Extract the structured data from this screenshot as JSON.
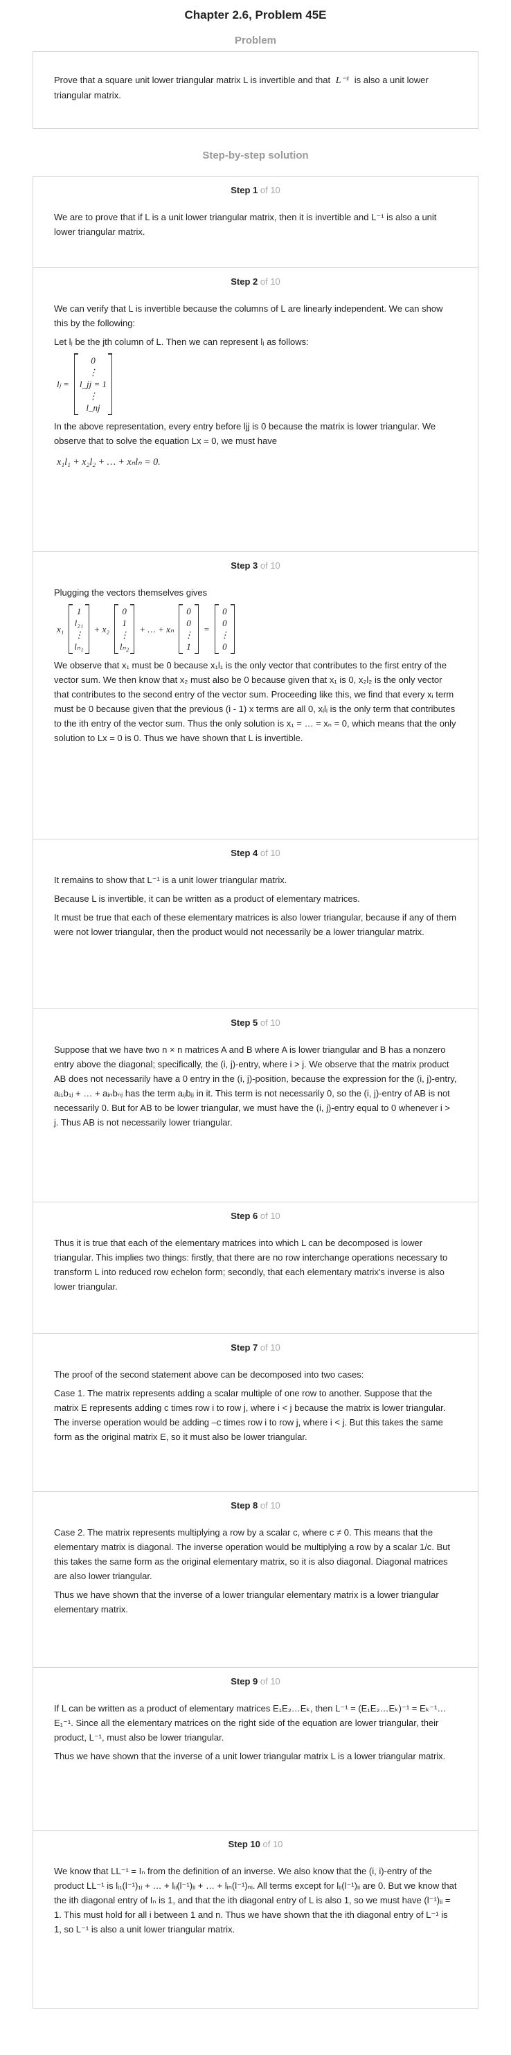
{
  "header": {
    "title": "Chapter 2.6, Problem 45E",
    "problem_heading": "Problem",
    "solution_heading": "Step-by-step solution"
  },
  "problem": {
    "text_before": "Prove that a square unit lower triangular matrix L is invertible and that",
    "math": "L⁻¹",
    "text_after": "is also a unit lower triangular matrix."
  },
  "steps": [
    {
      "label": "Step 1",
      "of": "of 10",
      "paragraphs": [
        "We are to prove that if L is a unit lower triangular matrix, then it is invertible and L⁻¹ is also a unit lower triangular matrix."
      ]
    },
    {
      "label": "Step 2",
      "of": "of 10",
      "paragraphs": [
        "We can verify that L is invertible because the columns of L are linearly independent. We can show this by the following:",
        "Let lⱼ be the jth column of L. Then we can represent lⱼ as follows:",
        "In the above representation, every entry before ljj is 0 because the matrix is lower triangular. We observe that to solve the equation Lx = 0, we must have",
        "x₁l₁ + x₂l₂ + … + xₙlₙ = 0."
      ],
      "vector_lhs": "lⱼ =",
      "vector_entries": [
        "0",
        "⋮",
        "l_jj = 1",
        "⋮",
        "l_nj"
      ]
    },
    {
      "label": "Step 3",
      "of": "of 10",
      "paragraphs": [
        "Plugging the vectors themselves gives",
        "We observe that x₁ must be 0 because x₁l₁ is the only vector that contributes to the first entry of the vector sum. We then know that x₂ must also be 0 because given that x₁ is 0, x₂l₂ is the only vector that contributes to the second entry of the vector sum. Proceeding like this, we find that every xᵢ term must be 0 because given that the previous (i - 1) x terms are all 0, xᵢlᵢ is the only term that contributes to the ith entry of the vector sum. Thus the only solution is x₁ = … = xₙ = 0, which means that the only solution to Lx = 0 is 0. Thus we have shown that L is invertible."
      ],
      "eq": {
        "v1": [
          "1",
          "l₂₁",
          "⋮",
          "lₙ₁"
        ],
        "v2": [
          "0",
          "1",
          "⋮",
          "lₙ₂"
        ],
        "vn": [
          "0",
          "0",
          "⋮",
          "1"
        ],
        "rhs": [
          "0",
          "0",
          "⋮",
          "0"
        ],
        "x1": "x₁",
        "x2": "+ x₂",
        "dots": "+ … + xₙ",
        "eq": "="
      }
    },
    {
      "label": "Step 4",
      "of": "of 10",
      "paragraphs": [
        "It remains to show that L⁻¹ is a unit lower triangular matrix.",
        "Because L is invertible, it can be written as a product of elementary matrices.",
        "It must be true that each of these elementary matrices is also lower triangular, because if any of them were not lower triangular, then the product would not necessarily be a lower triangular matrix."
      ]
    },
    {
      "label": "Step 5",
      "of": "of 10",
      "paragraphs": [
        "Suppose that we have two n × n matrices A and B where A is lower triangular and B has a nonzero entry above the diagonal; specifically, the (i, j)-entry, where i > j. We observe that the matrix product AB does not necessarily have a 0 entry in the (i, j)-position, because the expression for the (i, j)-entry, aᵢ₁b₁ⱼ + … + aᵢₙbₙⱼ has the term aᵢⱼbⱼⱼ in it. This term is not necessarily 0, so the (i, j)-entry of AB is not necessarily 0. But for AB to be lower triangular, we must have the (i, j)-entry equal to 0 whenever i > j. Thus AB is not necessarily lower triangular."
      ]
    },
    {
      "label": "Step 6",
      "of": "of 10",
      "paragraphs": [
        "Thus it is true that each of the elementary matrices into which L can be decomposed is lower triangular. This implies two things: firstly, that there are no row interchange operations necessary to transform L into reduced row echelon form; secondly, that each elementary matrix's inverse is also lower triangular."
      ]
    },
    {
      "label": "Step 7",
      "of": "of 10",
      "paragraphs": [
        "The proof of the second statement above can be decomposed into two cases:",
        "Case 1. The matrix represents adding a scalar multiple of one row to another. Suppose that the matrix E represents adding c times row i to row j, where i < j because the matrix is lower triangular. The inverse operation would be adding –c times row i to row j, where i < j. But this takes the same form as the original matrix E, so it must also be lower triangular."
      ]
    },
    {
      "label": "Step 8",
      "of": "of 10",
      "paragraphs": [
        "Case 2. The matrix represents multiplying a row by a scalar c, where c ≠ 0. This means that the elementary matrix is diagonal. The inverse operation would be multiplying a row by a scalar 1/c. But this takes the same form as the original elementary matrix, so it is also diagonal. Diagonal matrices are also lower triangular.",
        "Thus we have shown that the inverse of a lower triangular elementary matrix is a lower triangular elementary matrix."
      ]
    },
    {
      "label": "Step 9",
      "of": "of 10",
      "paragraphs": [
        "If L can be written as a product of elementary matrices E₁E₂…Eₖ, then L⁻¹ = (E₁E₂…Eₖ)⁻¹ = Eₖ⁻¹…E₁⁻¹. Since all the elementary matrices on the right side of the equation are lower triangular, their product, L⁻¹, must also be lower triangular.",
        "Thus we have shown that the inverse of a unit lower triangular matrix L is a lower triangular matrix."
      ]
    },
    {
      "label": "Step 10",
      "of": "of 10",
      "paragraphs": [
        "We know that LL⁻¹ = Iₙ from the definition of an inverse. We also know that the (i, i)-entry of the product LL⁻¹ is lᵢ₁(l⁻¹)₁ᵢ + … + lᵢᵢ(l⁻¹)ᵢᵢ + … + lᵢₙ(l⁻¹)ₙᵢ. All terms except for lᵢᵢ(l⁻¹)ᵢᵢ are 0. But we know that the ith diagonal entry of Iₙ is 1, and that the ith diagonal entry of L is also 1, so we must have (l⁻¹)ᵢᵢ = 1. This must hold for all i between 1 and n. Thus we have shown that the ith diagonal entry of L⁻¹ is 1, so L⁻¹ is also a unit lower triangular matrix."
      ]
    }
  ]
}
